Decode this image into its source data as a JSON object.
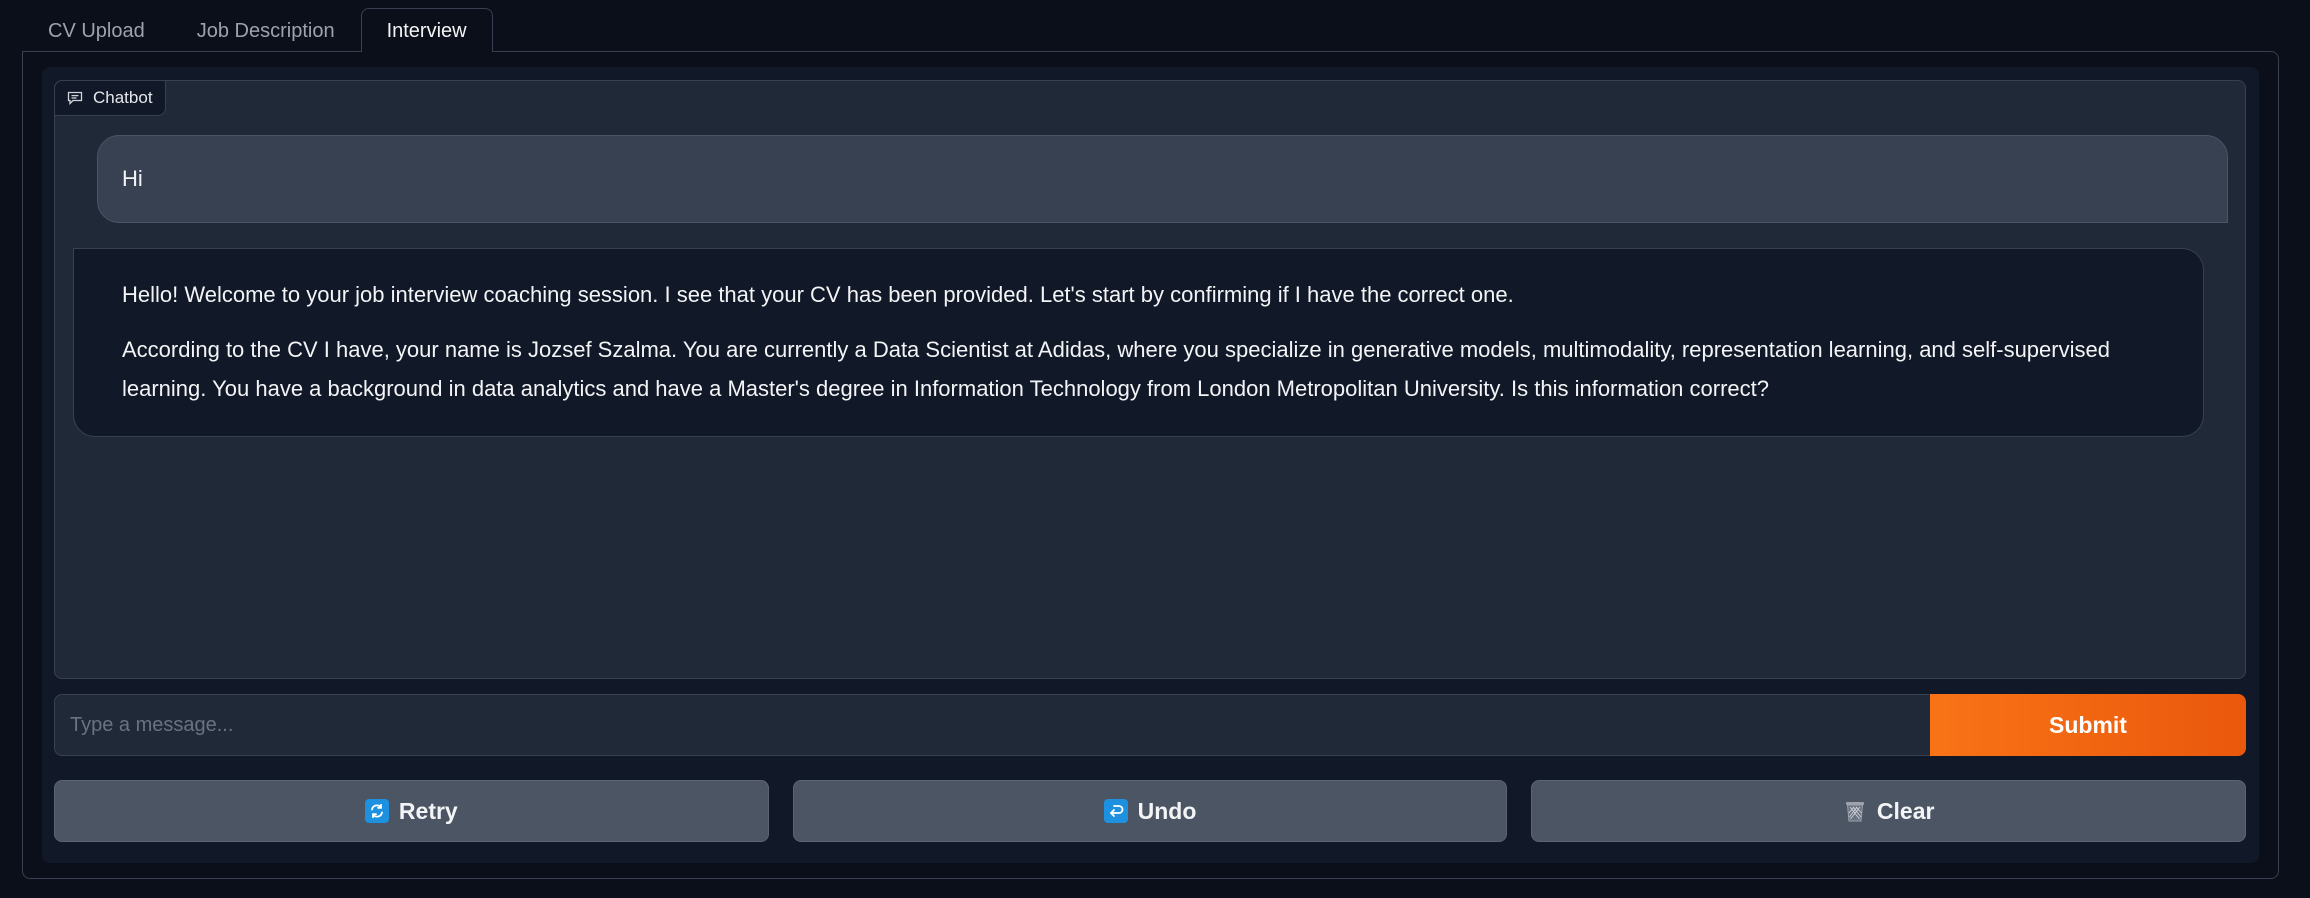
{
  "tabs": [
    {
      "label": "CV Upload",
      "active": false
    },
    {
      "label": "Job Description",
      "active": false
    },
    {
      "label": "Interview",
      "active": true
    }
  ],
  "chatbot": {
    "label": "Chatbot",
    "icon": "chat-bubble-icon",
    "messages": [
      {
        "role": "user",
        "text": "Hi"
      },
      {
        "role": "bot",
        "paragraphs": [
          "Hello! Welcome to your job interview coaching session. I see that your CV has been provided. Let's start by confirming if I have the correct one.",
          "According to the CV I have, your name is Jozsef Szalma. You are currently a Data Scientist at Adidas, where you specialize in generative models, multimodality, representation learning, and self-supervised learning. You have a background in data analytics and have a Master's degree in Information Technology from London Metropolitan University. Is this information correct?"
        ]
      }
    ]
  },
  "input": {
    "placeholder": "Type a message...",
    "value": "",
    "submit_label": "Submit"
  },
  "actions": {
    "retry_label": "Retry",
    "retry_icon": "retry-arrows-icon",
    "undo_label": "Undo",
    "undo_icon": "undo-arrow-icon",
    "clear_label": "Clear",
    "clear_icon": "wastebasket-icon"
  },
  "colors": {
    "background": "#0b0f19",
    "panel": "#111827",
    "chat_area": "#1f2937",
    "user_bubble": "#374151",
    "accent": "#f97316",
    "button": "#4b5563",
    "emoji_blue": "#1e90e0"
  }
}
